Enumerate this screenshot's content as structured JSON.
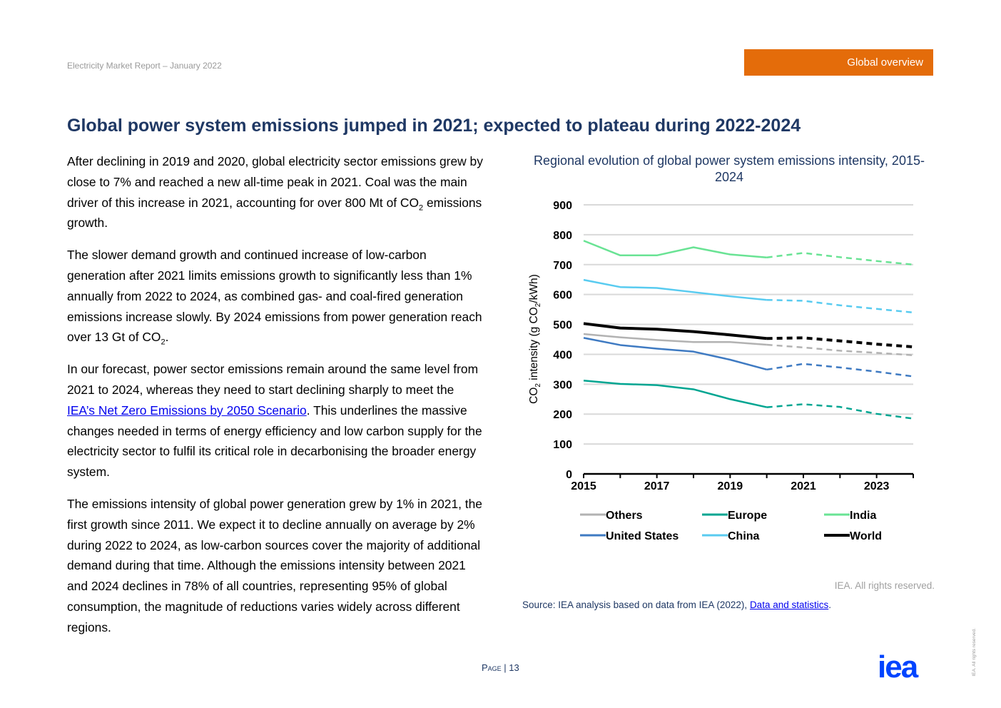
{
  "header": {
    "report": "Electricity Market Report – January 2022",
    "section": "Global overview"
  },
  "title": "Global power system emissions jumped in 2021; expected to plateau during 2022-2024",
  "body": {
    "p1_a": "After declining in 2019 and 2020, global electricity sector emissions grew by close to 7% and reached a new all-time peak in 2021. Coal was the main driver of this increase in 2021, accounting for over 800 Mt of CO",
    "p1_sub": "2",
    "p1_b": " emissions growth.",
    "p2_a": "The slower demand growth and continued increase of low-carbon generation after 2021 limits emissions growth to significantly less than 1% annually from 2022 to 2024, as combined gas- and coal-fired generation emissions increase slowly. By 2024 emissions from power generation reach over 13 Gt of CO",
    "p2_sub": "2",
    "p2_b": ".",
    "p3_a": "In our forecast, power sector emissions remain around the same level from 2021 to 2024, whereas they need to start declining sharply to meet the ",
    "p3_link": "IEA’s Net Zero Emissions by 2050 Scenario",
    "p3_b": ". This underlines the massive changes needed in terms of energy efficiency and low carbon supply for the electricity sector to fulfil its critical role in decarbonising the broader energy system.",
    "p4": "The emissions intensity of global power generation grew by 1% in 2021, the first growth since 2011. We expect it to decline annually on average by 2% during 2022 to 2024, as low-carbon sources cover the majority of additional demand during that time. Although the emissions intensity between 2021 and 2024 declines in 78% of all countries, representing 95% of global consumption, the magnitude of reductions varies widely across different regions."
  },
  "chart_data": {
    "type": "line",
    "title": "Regional evolution of global power system emissions intensity, 2015-2024",
    "ylabel_pre": "CO",
    "ylabel_sub": "2",
    "ylabel_mid": " intensity (g CO",
    "ylabel_post": "/kWh)",
    "ylim": [
      0,
      900
    ],
    "yticks": [
      "0",
      "100",
      "200",
      "300",
      "400",
      "500",
      "600",
      "700",
      "800",
      "900"
    ],
    "x": [
      2015,
      2016,
      2017,
      2018,
      2019,
      2020,
      2021,
      2022,
      2023,
      2024
    ],
    "xticks": [
      "2015",
      "2017",
      "2019",
      "2021",
      "2023"
    ],
    "forecast_from": 2020,
    "grid": true,
    "legend_placement": "bottom",
    "series": [
      {
        "name": "Others",
        "color": "#b2b2b2",
        "values": [
          468,
          457,
          448,
          441,
          441,
          432,
          423,
          412,
          405,
          397
        ]
      },
      {
        "name": "Europe",
        "color": "#00a591",
        "values": [
          312,
          301,
          297,
          283,
          250,
          223,
          233,
          224,
          201,
          185
        ]
      },
      {
        "name": "India",
        "color": "#69e394",
        "values": [
          780,
          731,
          731,
          758,
          734,
          724,
          739,
          725,
          712,
          700
        ]
      },
      {
        "name": "United States",
        "color": "#3e7ac2",
        "values": [
          455,
          431,
          419,
          409,
          382,
          349,
          368,
          356,
          342,
          326
        ]
      },
      {
        "name": "China",
        "color": "#58cbf0",
        "values": [
          649,
          625,
          622,
          608,
          594,
          582,
          579,
          564,
          552,
          540
        ]
      },
      {
        "name": "World",
        "color": "#000000",
        "values": [
          503,
          488,
          484,
          476,
          465,
          453,
          455,
          445,
          434,
          425
        ]
      }
    ]
  },
  "footer": {
    "rights": "IEA. All rights reserved.",
    "source_text": "Source: IEA analysis based on data from IEA (2022), ",
    "source_link": "Data and statistics",
    "source_end": ".",
    "page_word": "Page",
    "page_sep": " | ",
    "page_number": "13",
    "logo_text": "iea",
    "vertical_rights": "IEA. All rights reserved."
  },
  "colors": {
    "title_blue": "#1f3864",
    "accent_orange": "#e46c0a",
    "logo_blue": "#0044ff"
  }
}
